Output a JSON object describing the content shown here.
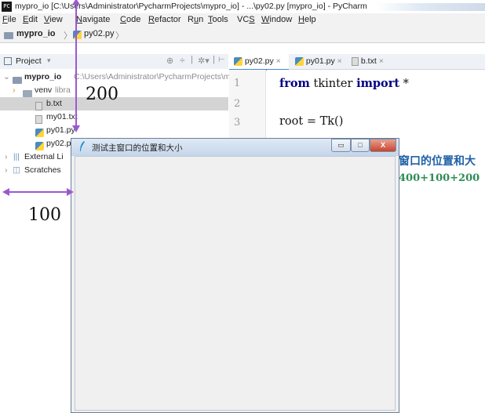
{
  "window": {
    "title": "mypro_io [C:\\Users\\Administrator\\PycharmProjects\\mypro_io] - ...\\py02.py [mypro_io] - PyCharm",
    "app_icon": "PC"
  },
  "menu": [
    {
      "label": "File",
      "ul": "F",
      "rest": "ile"
    },
    {
      "label": "Edit",
      "ul": "E",
      "rest": "dit"
    },
    {
      "label": "View",
      "ul": "V",
      "rest": "iew"
    },
    {
      "label": "Navigate",
      "ul": "N",
      "rest": "avigate"
    },
    {
      "label": "Code",
      "ul": "C",
      "rest": "ode"
    },
    {
      "label": "Refactor",
      "ul": "R",
      "rest": "efactor"
    },
    {
      "label": "Run",
      "pre": "R",
      "ul": "u",
      "rest": "n"
    },
    {
      "label": "Tools",
      "ul": "T",
      "rest": "ools"
    },
    {
      "label": "VCS",
      "pre": "VC",
      "ul": "S",
      "rest": ""
    },
    {
      "label": "Window",
      "ul": "W",
      "rest": "indow"
    },
    {
      "label": "Help",
      "ul": "H",
      "rest": "elp"
    }
  ],
  "breadcrumb": {
    "project": "mypro_io",
    "file": "py02.py"
  },
  "project_panel": {
    "header": "Project",
    "tree": {
      "root": {
        "name": "mypro_io",
        "path": "C:\\Users\\Administrator\\PycharmProjects\\m"
      },
      "venv": {
        "name": "venv",
        "suffix": "libra"
      },
      "files": [
        "b.txt",
        "my01.txt",
        "py01.py",
        "py02.p"
      ],
      "external": "External Li",
      "scratches": "Scratches"
    }
  },
  "editor": {
    "tabs": [
      "py02.py",
      "py01.py",
      "b.txt"
    ],
    "line_numbers": [
      "1",
      "2",
      "3"
    ],
    "line1": {
      "kw1": "from",
      "mod": " tkinter ",
      "kw2": "import",
      "rest": " *"
    },
    "line3": "root = Tk()",
    "partial1": "窗口的位置和大",
    "partial2": "400+100+200"
  },
  "tk_window": {
    "title": "测试主窗口的位置和大小",
    "min": "▭",
    "max": "□",
    "close": "X"
  },
  "annotations": {
    "y_offset": "200",
    "x_offset": "100"
  },
  "colors": {
    "accent": "#9b59d0",
    "keyword": "#000080",
    "green_text": "#2e8b57",
    "partial_blue": "#1f5fa6"
  }
}
